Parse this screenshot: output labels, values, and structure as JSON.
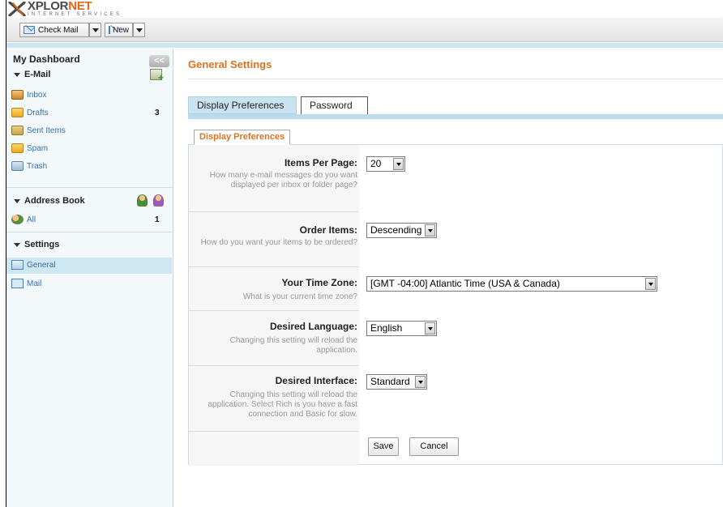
{
  "brand": {
    "logo_main_a": "XPLOR",
    "logo_main_b": "NET",
    "logo_sub": "INTERNET SERVICES"
  },
  "toolbar": {
    "check_mail_label": "Check Mail",
    "new_label": "New"
  },
  "sidebar": {
    "title": "My Dashboard",
    "collapse_label": "<<",
    "email": {
      "label": "E-Mail",
      "items": [
        {
          "label": "Inbox",
          "count": ""
        },
        {
          "label": "Drafts",
          "count": "3"
        },
        {
          "label": "Sent Items",
          "count": ""
        },
        {
          "label": "Spam",
          "count": ""
        },
        {
          "label": "Trash",
          "count": ""
        }
      ]
    },
    "address_book": {
      "label": "Address Book",
      "items": [
        {
          "label": "All",
          "count": "1"
        }
      ]
    },
    "settings": {
      "label": "Settings",
      "items": [
        {
          "label": "General",
          "selected": true
        },
        {
          "label": "Mail",
          "selected": false
        }
      ]
    }
  },
  "main": {
    "title": "General Settings",
    "tabs": [
      {
        "label": "Display Preferences",
        "active": true
      },
      {
        "label": "Password",
        "active": false
      }
    ],
    "subtab": "Display Preferences",
    "fields": [
      {
        "label": "Items Per Page:",
        "help": "How many e-mail messages do you want displayed per inbox or folder page?",
        "value": "20"
      },
      {
        "label": "Order Items:",
        "help": "How do you want your items to be ordered?",
        "value": "Descending"
      },
      {
        "label": "Your Time Zone:",
        "help": "What is your current time zone?",
        "value": "[GMT -04:00] Atlantic Time (USA & Canada)"
      },
      {
        "label": "Desired Language:",
        "help": "Changing this setting will reload the application.",
        "value": "English"
      },
      {
        "label": "Desired Interface:",
        "help": "Changing this setting will reload the application. Select Rich is you have a fast connection and Basic for slow.",
        "value": "Standard"
      }
    ],
    "save_label": "Save",
    "cancel_label": "Cancel"
  },
  "colors": {
    "accent_orange": "#d8731f",
    "link_blue": "#3a6ea5",
    "band_blue": "#b9dced",
    "selected_row": "#cde7f3"
  }
}
